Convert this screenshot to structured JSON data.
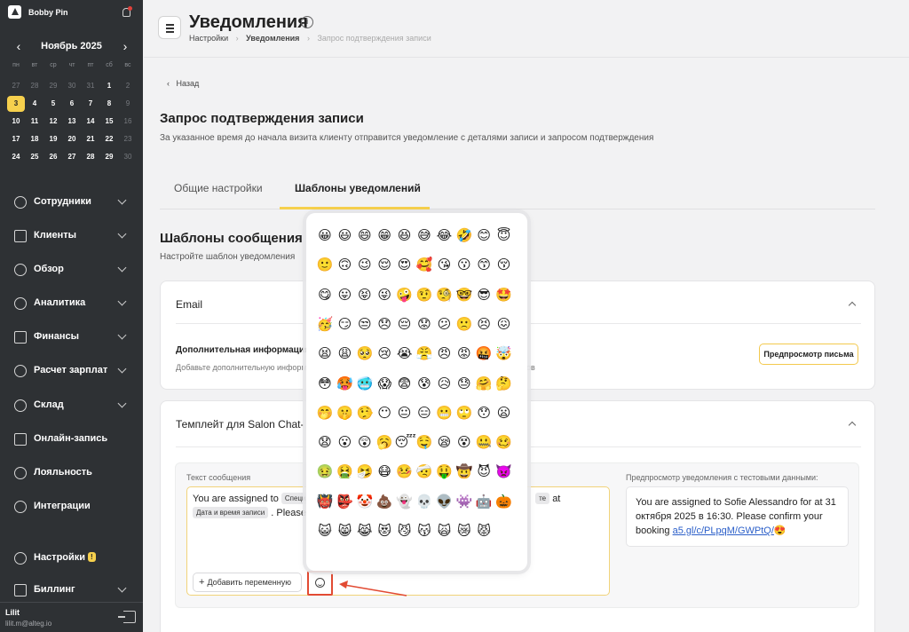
{
  "sidebar": {
    "company": "Bobby Pin",
    "calendar": {
      "month": "Ноябрь 2025",
      "weekdays": [
        "пн",
        "вт",
        "ср",
        "чт",
        "пт",
        "сб",
        "вс"
      ],
      "weeks": [
        [
          "27",
          "28",
          "29",
          "30",
          "31",
          "1",
          "2"
        ],
        [
          "3",
          "4",
          "5",
          "6",
          "7",
          "8",
          "9"
        ],
        [
          "10",
          "11",
          "12",
          "13",
          "14",
          "15",
          "16"
        ],
        [
          "17",
          "18",
          "19",
          "20",
          "21",
          "22",
          "23"
        ],
        [
          "24",
          "25",
          "26",
          "27",
          "28",
          "29",
          "30"
        ]
      ],
      "today": "3"
    },
    "nav": [
      {
        "label": "Сотрудники",
        "icon": "user-icon"
      },
      {
        "label": "Клиенты",
        "icon": "clients-icon"
      },
      {
        "label": "Обзор",
        "icon": "overview-icon"
      },
      {
        "label": "Аналитика",
        "icon": "analytics-icon"
      },
      {
        "label": "Финансы",
        "icon": "finance-icon"
      },
      {
        "label": "Расчет зарплат",
        "icon": "payroll-icon"
      },
      {
        "label": "Склад",
        "icon": "warehouse-icon"
      },
      {
        "label": "Онлайн-запись",
        "icon": "globe-icon"
      },
      {
        "label": "Лояльность",
        "icon": "loyalty-icon"
      },
      {
        "label": "Интеграции",
        "icon": "integrations-icon"
      }
    ],
    "settings": {
      "label": "Настройки",
      "badge": "!"
    },
    "billing": {
      "label": "Биллинг"
    },
    "user": {
      "name": "Lilit",
      "email": "lilit.m@alteg.io"
    }
  },
  "header": {
    "title": "Уведомления",
    "breadcrumbs": [
      "Настройки",
      "Уведомления",
      "Запрос подтверждения записи"
    ]
  },
  "page": {
    "back": "Назад",
    "title": "Запрос подтверждения записи",
    "description": "За указанное время до начала визита клиенту отправится уведомление с деталями записи и запросом подтверждения",
    "tabs": [
      "Общие настройки",
      "Шаблоны уведомлений"
    ],
    "section_title": "Шаблоны сообщения",
    "section_sub": "Настройте шаблон уведомления"
  },
  "email_card": {
    "title": "Email",
    "extra_title": "Дополнительная информация",
    "extra_sub": "Добавьте дополнительную информацию",
    "extra_sub_tail": "тов",
    "preview_button": "Предпросмотр письма"
  },
  "chat_card": {
    "title": "Темплейт для Salon Chat-",
    "text_label": "Текст сообщения",
    "message": {
      "part1": "You are assigned to",
      "token1": "Специа",
      "token2": "те",
      "part2": "at",
      "token3": "Дата и время записи",
      "part3": ". Please"
    },
    "add_variable": "Добавить переменную",
    "preview_label": "Предпросмотр уведомления с тестовыми данными:",
    "preview_text": "You are assigned to  Sofie Alessandro for  at 31 октября 2025 в 16:30. Please confirm your booking ",
    "preview_link": "a5.gl/c/PLpqM/GWPtQ/",
    "preview_emoji": "😍"
  },
  "emoji_picker": {
    "rows": [
      [
        "😀",
        "😃",
        "😄",
        "😁",
        "😆",
        "😅",
        "😂",
        "🤣",
        "😊",
        "😇"
      ],
      [
        "🙂",
        "🙃",
        "😉",
        "😌",
        "😍",
        "🥰",
        "😘",
        "😗",
        "😙",
        "😚"
      ],
      [
        "😋",
        "😛",
        "😝",
        "😜",
        "🤪",
        "🤨",
        "🧐",
        "🤓",
        "😎",
        "🤩"
      ],
      [
        "🥳",
        "😏",
        "😒",
        "😞",
        "😔",
        "😟",
        "😕",
        "🙁",
        "😣",
        "😖"
      ],
      [
        "😫",
        "😩",
        "🥺",
        "😢",
        "😭",
        "😤",
        "😠",
        "😡",
        "🤬",
        "🤯"
      ],
      [
        "😳",
        "🥵",
        "🥶",
        "😱",
        "😨",
        "😰",
        "😥",
        "😓",
        "🤗",
        "🤔"
      ],
      [
        "🤭",
        "🤫",
        "🤥",
        "😶",
        "😐",
        "😑",
        "😬",
        "🙄",
        "😯",
        "😦"
      ],
      [
        "😧",
        "😮",
        "😲",
        "🥱",
        "😴",
        "🤤",
        "😪",
        "😵",
        "🤐",
        "🥴"
      ],
      [
        "🤢",
        "🤮",
        "🤧",
        "😷",
        "🤒",
        "🤕",
        "🤑",
        "🤠",
        "😈",
        "👿"
      ],
      [
        "👹",
        "👺",
        "🤡",
        "💩",
        "👻",
        "💀",
        "👽",
        "👾",
        "🤖",
        "🎃"
      ],
      [
        "😺",
        "😸",
        "😹",
        "😻",
        "😼",
        "😽",
        "🙀",
        "😿",
        "😾"
      ]
    ]
  }
}
